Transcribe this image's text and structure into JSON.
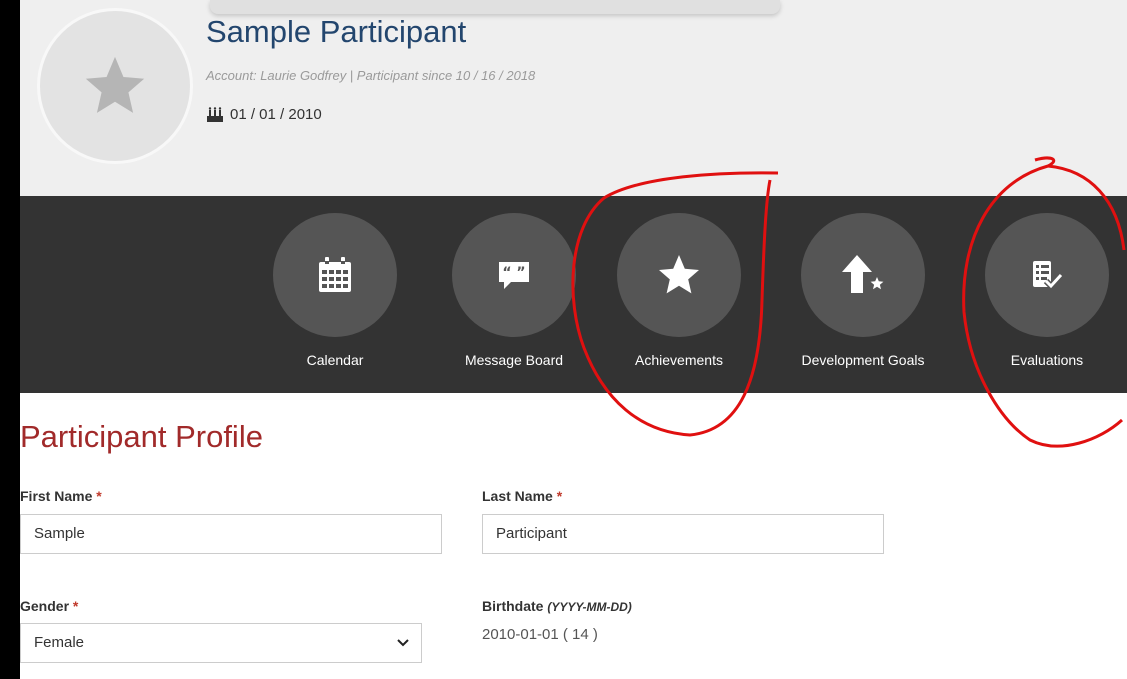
{
  "participant": {
    "name": "Sample Participant",
    "account_line": "Account: Laurie Godfrey | Participant since 10 / 16 / 2018",
    "birthday": "01 / 01 / 2010"
  },
  "nav": {
    "items": [
      {
        "label": "Calendar",
        "icon": "calendar-icon"
      },
      {
        "label": "Message Board",
        "icon": "message-board-icon"
      },
      {
        "label": "Achievements",
        "icon": "star-icon"
      },
      {
        "label": "Development Goals",
        "icon": "arrow-up-star-icon"
      },
      {
        "label": "Evaluations",
        "icon": "evaluation-checklist-icon"
      }
    ]
  },
  "profile": {
    "title": "Participant Profile",
    "first_name_label": "First Name",
    "first_name_value": "Sample",
    "last_name_label": "Last Name",
    "last_name_value": "Participant",
    "gender_label": "Gender",
    "gender_value": "Female",
    "birthdate_label": "Birthdate",
    "birthdate_format": "(YYYY-MM-DD)",
    "birthdate_value": "2010-01-01 ( 14 )",
    "required_mark": "*"
  },
  "colors": {
    "name": "#23466e",
    "title": "#a12a2a",
    "navbar": "#333333",
    "nav_circle": "#555555",
    "annotation": "#e01010"
  }
}
